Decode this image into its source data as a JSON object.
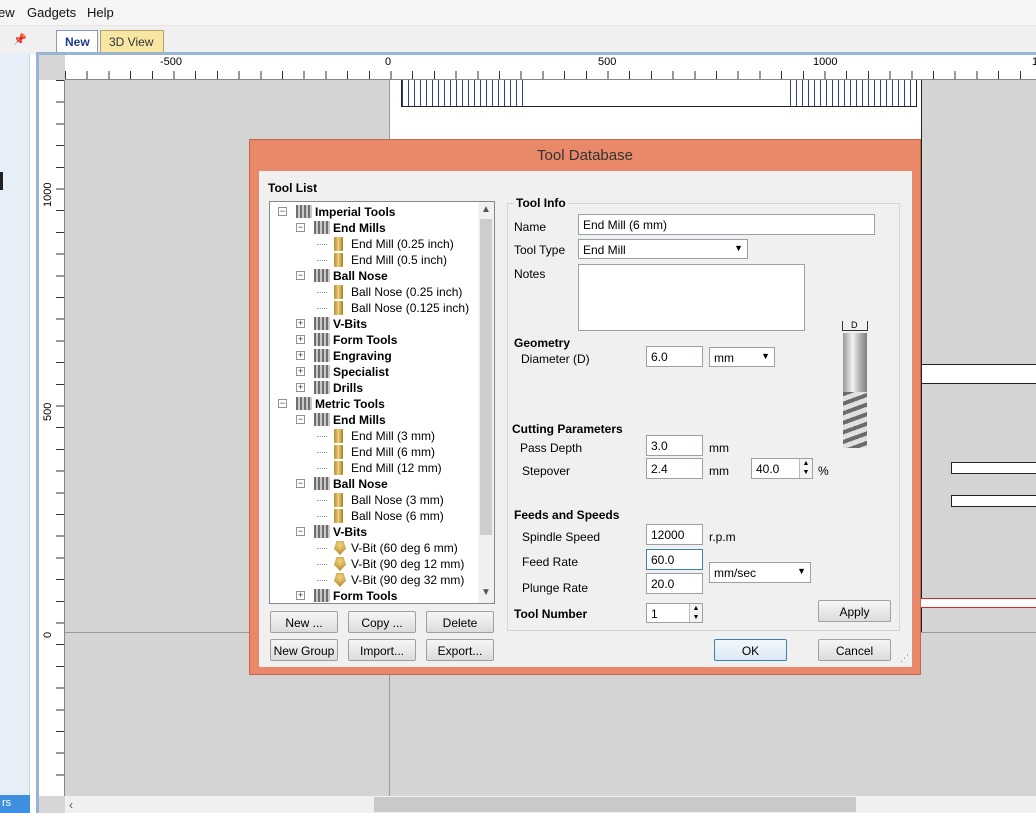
{
  "menu": {
    "view_partial": "ew",
    "gadgets": "Gadgets",
    "help": "Help"
  },
  "tabs": {
    "new": "New",
    "view3d": "3D View"
  },
  "left_panel": {
    "tab_partial": "rs"
  },
  "ruler": {
    "h_labels": [
      "-500",
      "0",
      "500",
      "1000",
      "1"
    ],
    "v_labels": [
      "1000",
      "500",
      "0"
    ]
  },
  "dialog": {
    "title": "Tool Database",
    "tool_list_label": "Tool List",
    "tree": [
      {
        "label": "Imperial Tools",
        "level": 0,
        "type": "group",
        "expanded": true
      },
      {
        "label": "End Mills",
        "level": 1,
        "type": "group",
        "expanded": true
      },
      {
        "label": "End Mill (0.25 inch)",
        "level": 2,
        "type": "tool"
      },
      {
        "label": "End Mill (0.5 inch)",
        "level": 2,
        "type": "tool"
      },
      {
        "label": "Ball Nose",
        "level": 1,
        "type": "group",
        "expanded": true
      },
      {
        "label": "Ball Nose (0.25 inch)",
        "level": 2,
        "type": "tool"
      },
      {
        "label": "Ball Nose (0.125 inch)",
        "level": 2,
        "type": "tool"
      },
      {
        "label": "V-Bits",
        "level": 1,
        "type": "group",
        "expanded": false
      },
      {
        "label": "Form Tools",
        "level": 1,
        "type": "group",
        "expanded": false
      },
      {
        "label": "Engraving",
        "level": 1,
        "type": "group",
        "expanded": false
      },
      {
        "label": "Specialist",
        "level": 1,
        "type": "group",
        "expanded": false
      },
      {
        "label": "Drills",
        "level": 1,
        "type": "group",
        "expanded": false
      },
      {
        "label": "Metric Tools",
        "level": 0,
        "type": "group",
        "expanded": true
      },
      {
        "label": "End Mills",
        "level": 1,
        "type": "group",
        "expanded": true
      },
      {
        "label": "End Mill (3 mm)",
        "level": 2,
        "type": "tool"
      },
      {
        "label": "End Mill (6 mm)",
        "level": 2,
        "type": "tool"
      },
      {
        "label": "End Mill (12 mm)",
        "level": 2,
        "type": "tool"
      },
      {
        "label": "Ball Nose",
        "level": 1,
        "type": "group",
        "expanded": true
      },
      {
        "label": "Ball Nose (3 mm)",
        "level": 2,
        "type": "tool"
      },
      {
        "label": "Ball Nose (6 mm)",
        "level": 2,
        "type": "tool"
      },
      {
        "label": "V-Bits",
        "level": 1,
        "type": "group",
        "expanded": true
      },
      {
        "label": "V-Bit (60 deg 6 mm)",
        "level": 2,
        "type": "vbit"
      },
      {
        "label": "V-Bit (90 deg 12 mm)",
        "level": 2,
        "type": "vbit"
      },
      {
        "label": "V-Bit (90 deg 32 mm)",
        "level": 2,
        "type": "vbit"
      },
      {
        "label": "Form Tools",
        "level": 1,
        "type": "group",
        "expanded": false
      }
    ],
    "buttons": {
      "new": "New ...",
      "copy": "Copy ...",
      "delete": "Delete",
      "new_group": "New Group",
      "import": "Import...",
      "export": "Export...",
      "apply": "Apply",
      "ok": "OK",
      "cancel": "Cancel"
    },
    "tool_info": {
      "header": "Tool Info",
      "name_label": "Name",
      "name_value": "End Mill (6 mm)",
      "type_label": "Tool Type",
      "type_value": "End Mill",
      "notes_label": "Notes",
      "notes_value": ""
    },
    "geometry": {
      "header": "Geometry",
      "diameter_label": "Diameter (D)",
      "diameter_value": "6.0",
      "units_value": "mm",
      "diagram_label": "D"
    },
    "cutting": {
      "header": "Cutting Parameters",
      "pass_depth_label": "Pass Depth",
      "pass_depth_value": "3.0",
      "pass_depth_unit": "mm",
      "stepover_label": "Stepover",
      "stepover_value": "2.4",
      "stepover_unit": "mm",
      "stepover_pct_value": "40.0",
      "pct_symbol": "%"
    },
    "feeds": {
      "header": "Feeds and Speeds",
      "spindle_label": "Spindle Speed",
      "spindle_value": "12000",
      "spindle_unit": "r.p.m",
      "feed_label": "Feed Rate",
      "feed_value": "60.0",
      "plunge_label": "Plunge Rate",
      "plunge_value": "20.0",
      "rate_units_value": "mm/sec"
    },
    "tool_number": {
      "label": "Tool Number",
      "value": "1"
    }
  }
}
